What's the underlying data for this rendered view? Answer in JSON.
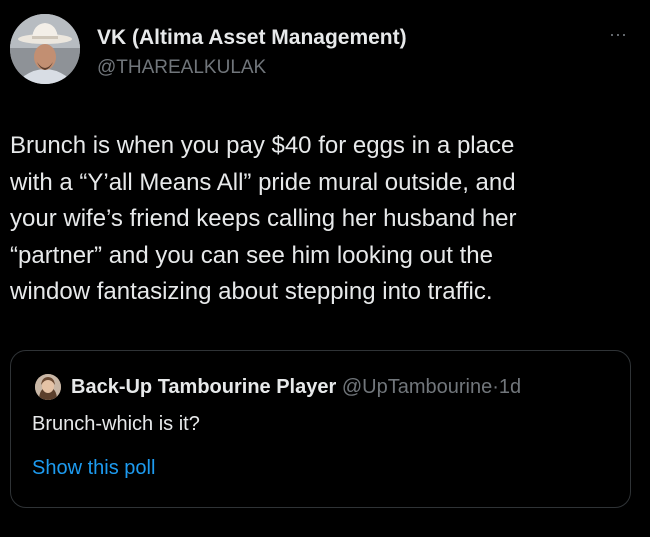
{
  "author": {
    "name": "VK (Altima Asset Management)",
    "handle": "@THAREALKULAK",
    "avatar_icon": "cowboy-hat-avatar"
  },
  "more_icon": "more-horizontal-icon",
  "more_glyph": "···",
  "tweet_lines": [
    "Brunch is when you pay $40 for eggs in a place",
    "with a “Y’all Means All” pride mural outside, and",
    "your wife’s friend keeps calling her husband her",
    "“partner” and you can see him looking out the",
    "window fantasizing about stepping into traffic."
  ],
  "quoted": {
    "name": "Back-Up Tambourine Player",
    "handle": "@UpTambourine",
    "separator": "·",
    "time": "1d",
    "text": "Brunch-which is it?",
    "poll_link": "Show this poll",
    "avatar_icon": "user-avatar"
  },
  "colors": {
    "background": "#000000",
    "primary_text": "#e7e9ea",
    "secondary_text": "#71767b",
    "link": "#1d9bf0",
    "border": "#2f3336"
  }
}
